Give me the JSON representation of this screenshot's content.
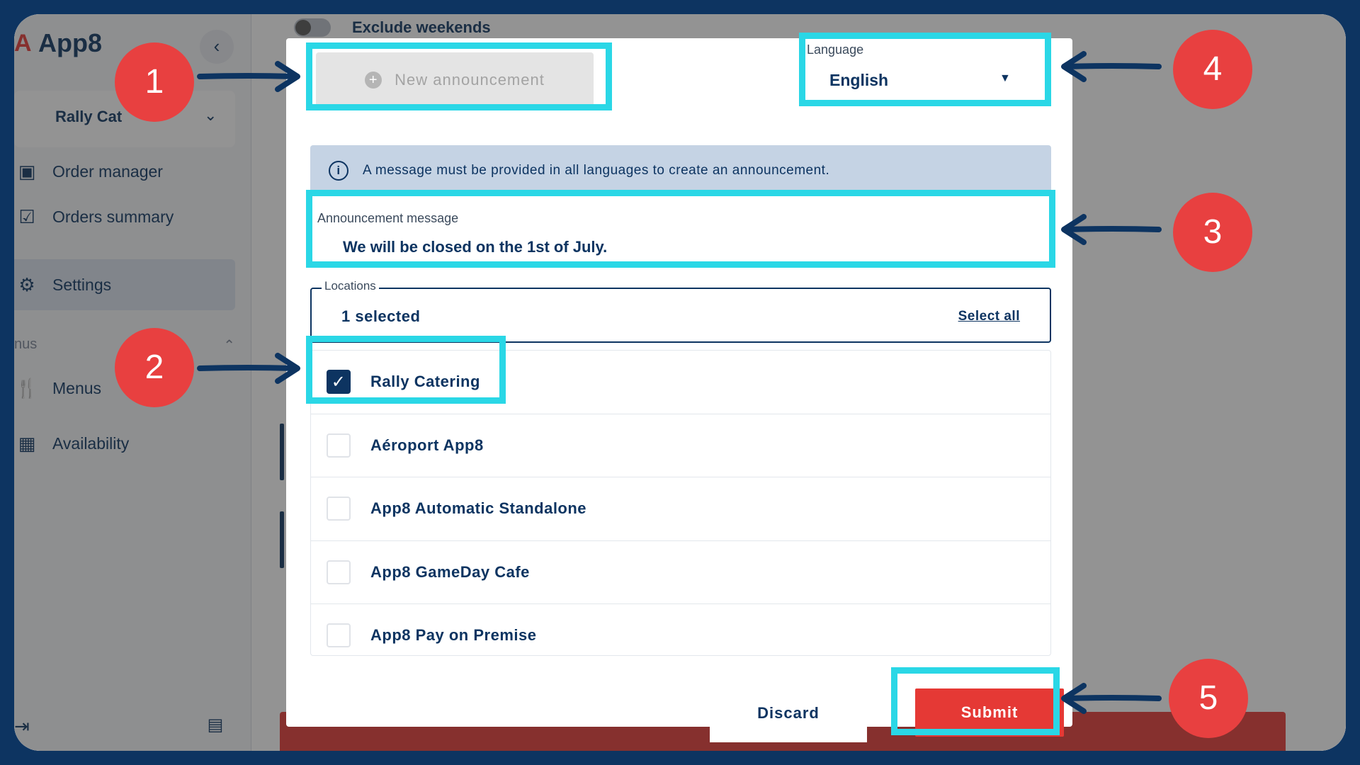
{
  "sidebar": {
    "logo_text": "App8",
    "collapse_glyph": "‹",
    "venue_label": "Rally Cat",
    "items": [
      {
        "label": "Order manager",
        "icon": "order-manager-icon"
      },
      {
        "label": "Orders summary",
        "icon": "clipboard-check-icon"
      },
      {
        "label": "Settings",
        "icon": "gear-icon"
      },
      {
        "label": "Menus",
        "icon": "fork-knife-icon"
      },
      {
        "label": "Availability",
        "icon": "calendar-icon"
      }
    ],
    "section_label": "nus"
  },
  "background": {
    "exclude_weekends_label": "Exclude weekends"
  },
  "modal": {
    "new_announcement_label": "New announcement",
    "language": {
      "label": "Language",
      "value": "English"
    },
    "info_text": "A message must be provided in all languages to create an announcement.",
    "message": {
      "label": "Announcement message",
      "value": "We will be closed on the 1st of July."
    },
    "locations": {
      "label": "Locations",
      "value": "1 selected",
      "select_all": "Select all"
    },
    "location_options": [
      {
        "label": "Rally Catering",
        "checked": true
      },
      {
        "label": "Aéroport App8",
        "checked": false
      },
      {
        "label": "App8 Automatic Standalone",
        "checked": false
      },
      {
        "label": "App8 GameDay Cafe",
        "checked": false
      },
      {
        "label": "App8 Pay on Premise",
        "checked": false
      }
    ],
    "discard_label": "Discard",
    "submit_label": "Submit"
  },
  "callouts": [
    "1",
    "2",
    "3",
    "4",
    "5"
  ],
  "colors": {
    "navy": "#0d3461",
    "highlight": "#2ad7e6",
    "callout": "#e84040",
    "submit": "#e53935"
  }
}
